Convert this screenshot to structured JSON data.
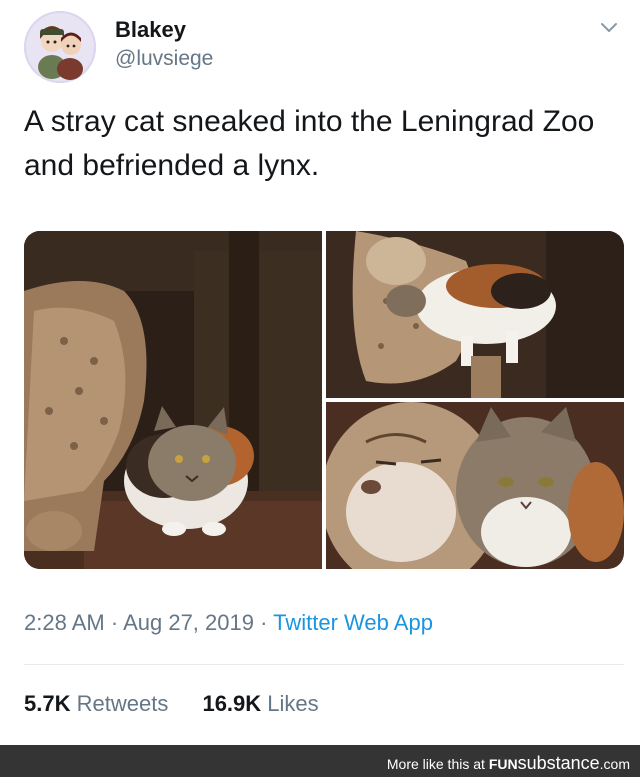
{
  "user": {
    "display_name": "Blakey",
    "handle": "@luvsiege",
    "avatar_icon": "avatar-illustration"
  },
  "tweet": {
    "text": "A stray cat sneaked into the Leningrad Zoo and befriended a lynx."
  },
  "media": {
    "count": 3
  },
  "meta": {
    "time": "2:28 AM",
    "separator": "·",
    "date": "Aug 27, 2019",
    "source": "Twitter Web App"
  },
  "stats": {
    "retweets_count": "5.7K",
    "retweets_label": "Retweets",
    "likes_count": "16.9K",
    "likes_label": "Likes"
  },
  "footer": {
    "promo_text": "More like this at",
    "brand_prefix": "FUN",
    "brand_suffix": "substance",
    "brand_tld": ".com"
  },
  "colors": {
    "link": "#1b95e0",
    "secondary_text": "#657786",
    "footer_bg": "#343434"
  }
}
